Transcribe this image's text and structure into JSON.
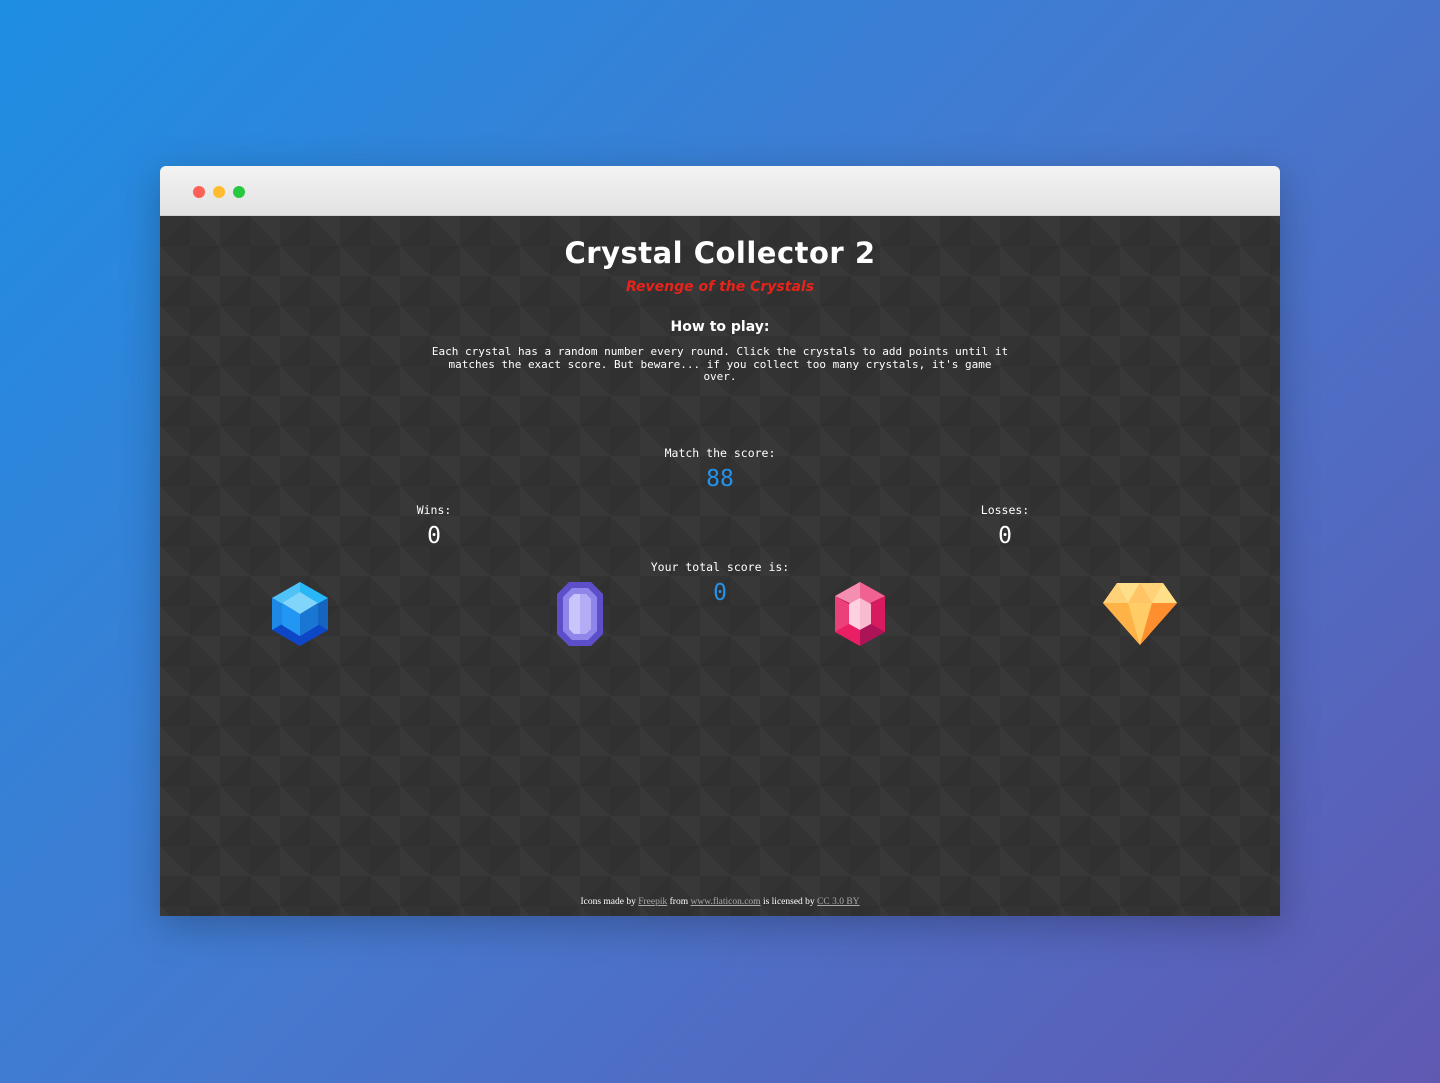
{
  "game": {
    "title": "Crystal Collector 2",
    "subtitle": "Revenge of the Crystals",
    "how_to_heading": "How to play:",
    "instructions": "Each crystal has a random number every round. Click the crystals to add points until it matches the exact score. But beware... if you collect too many crystals, it's game over.",
    "match_label": "Match the score:",
    "match_value": "88",
    "wins_label": "Wins:",
    "wins_value": "0",
    "losses_label": "Losses:",
    "losses_value": "0",
    "total_label": "Your total score is:",
    "total_value": "0"
  },
  "crystals": [
    {
      "icon": "blue-hexagon-gem-icon",
      "color": "#1e88e5"
    },
    {
      "icon": "purple-octagon-gem-icon",
      "color": "#7b6fe0"
    },
    {
      "icon": "pink-ruby-gem-icon",
      "color": "#ee2d6a"
    },
    {
      "icon": "orange-diamond-gem-icon",
      "color": "#ffb74d"
    }
  ],
  "footer": {
    "prefix": "Icons made by",
    "author_link": "Freepik",
    "from_text": "from",
    "site_link": "www.flaticon.com",
    "licensed_text": "is licensed by",
    "license_link": "CC 3.0 BY"
  },
  "colors": {
    "accent_blue": "#2592ea",
    "subtitle_red": "#e8231a",
    "background": "#333333"
  }
}
